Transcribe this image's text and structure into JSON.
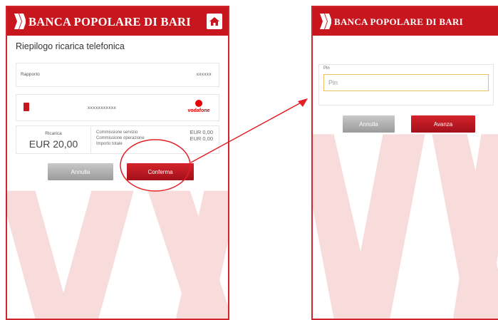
{
  "left_screen": {
    "bank_name": "BANCA POPOLARE DI BARI",
    "title": "Riepilogo ricarica telefonica",
    "rapporto_label": "Rapporto",
    "rapporto_value": "xxxxxx",
    "phone_number": "xxxxxxxxxxx",
    "operator": "vodafone",
    "ricarica_label": "Ricarica",
    "ricarica_value": "EUR 20,00",
    "fees": [
      "Commissione servizio",
      "Commissione operazione",
      "Importo totale"
    ],
    "fee_amounts": [
      "EUR 0,00",
      "EUR 0,00"
    ],
    "annulla_label": "Annulla",
    "conferma_label": "Conferma"
  },
  "right_screen": {
    "bank_name": "BANCA POPOLARE DI BARI",
    "pin_label": "Pin",
    "pin_placeholder": "Pin",
    "annulla_label": "Annulla",
    "avanti_label": "Avanza"
  },
  "colors": {
    "brand_red": "#c8161e",
    "highlight_red": "#e31e24",
    "watermark": "#f6dada"
  },
  "icons": {
    "home": "home-icon",
    "logo": "bank-logo-icon",
    "sim": "sim-card-icon",
    "operator": "vodafone-logo"
  }
}
